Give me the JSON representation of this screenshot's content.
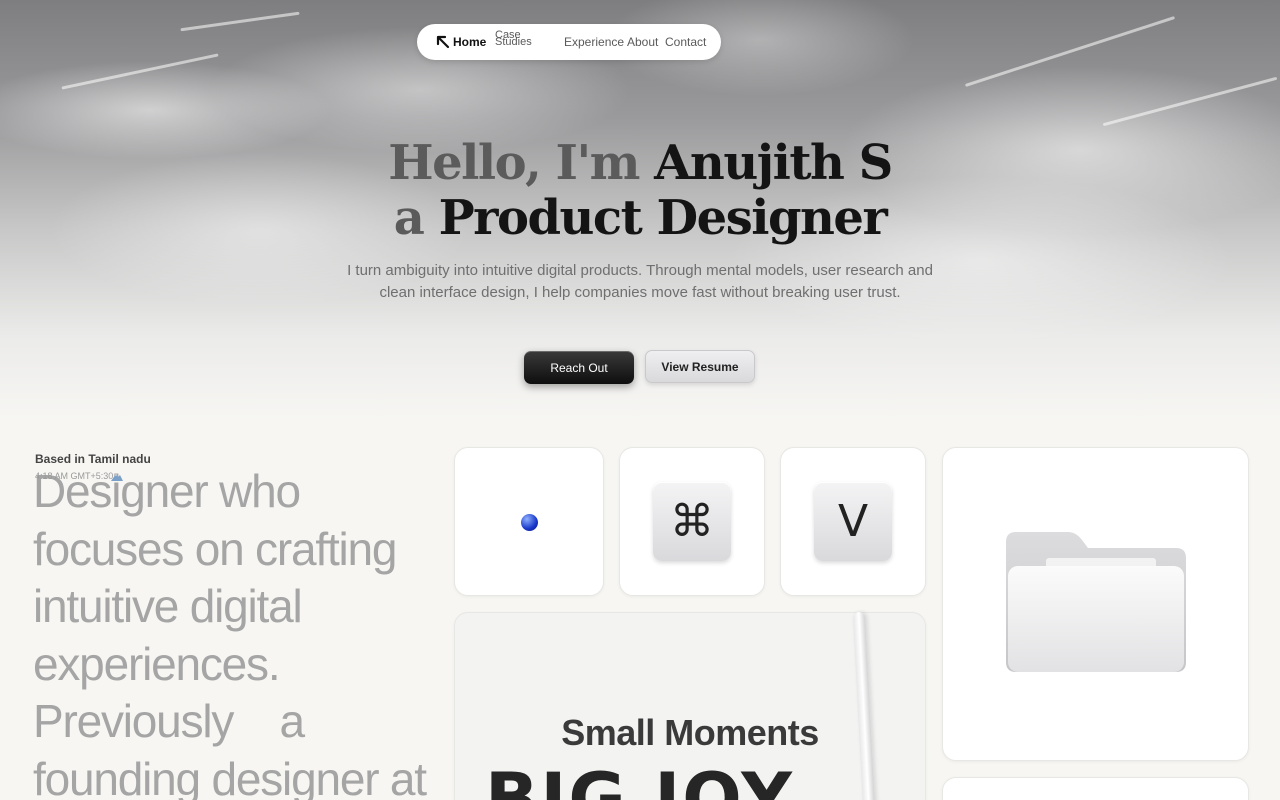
{
  "nav": {
    "home": "Home",
    "case_studies": "Case Studies",
    "experience": "Experience",
    "about": "About",
    "contact": "Contact"
  },
  "hero": {
    "line1_muted": "Hello, I'm",
    "line1_strong": "Anujith S",
    "line2_muted": "a",
    "line2_strong": "Product Designer",
    "subtitle": "I turn ambiguity into intuitive digital products. Through mental models,  user research and clean interface design, I help companies move fast without breaking user trust.",
    "cta_primary": "Reach Out",
    "cta_secondary": "View Resume"
  },
  "profile": {
    "based_in": "Based in Tamil nadu",
    "local_time": "4:18 AM GMT+5:30",
    "bio_lines": [
      "Designer who",
      "focuses on crafting",
      "intuitive digital",
      "experiences.",
      "Previously    a",
      "founding designer at"
    ]
  },
  "cards": {
    "cmd_key": "⌘",
    "v_key": "V",
    "poster_small": "Small Moments",
    "poster_big": "BIG JOY"
  },
  "colors": {
    "background": "#f7f6f3",
    "primary_button": "#141414",
    "text_muted": "#a5a5a5"
  }
}
